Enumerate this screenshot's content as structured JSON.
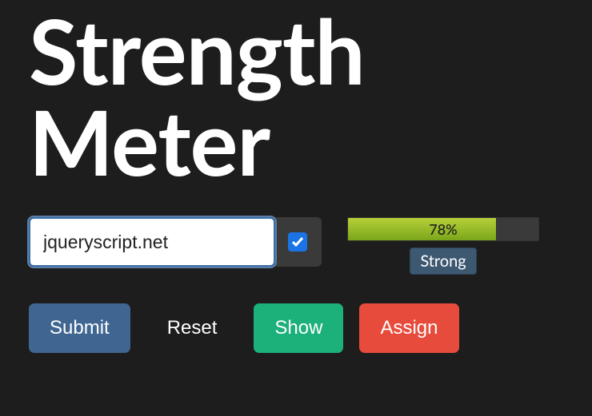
{
  "title": "Strength Meter",
  "input": {
    "value": "jqueryscript.net",
    "checkbox_checked": true
  },
  "meter": {
    "percent": 78,
    "percent_label": "78%",
    "strength_label": "Strong",
    "fill_color": "#9fc428"
  },
  "buttons": {
    "submit": "Submit",
    "reset": "Reset",
    "show": "Show",
    "assign": "Assign"
  }
}
